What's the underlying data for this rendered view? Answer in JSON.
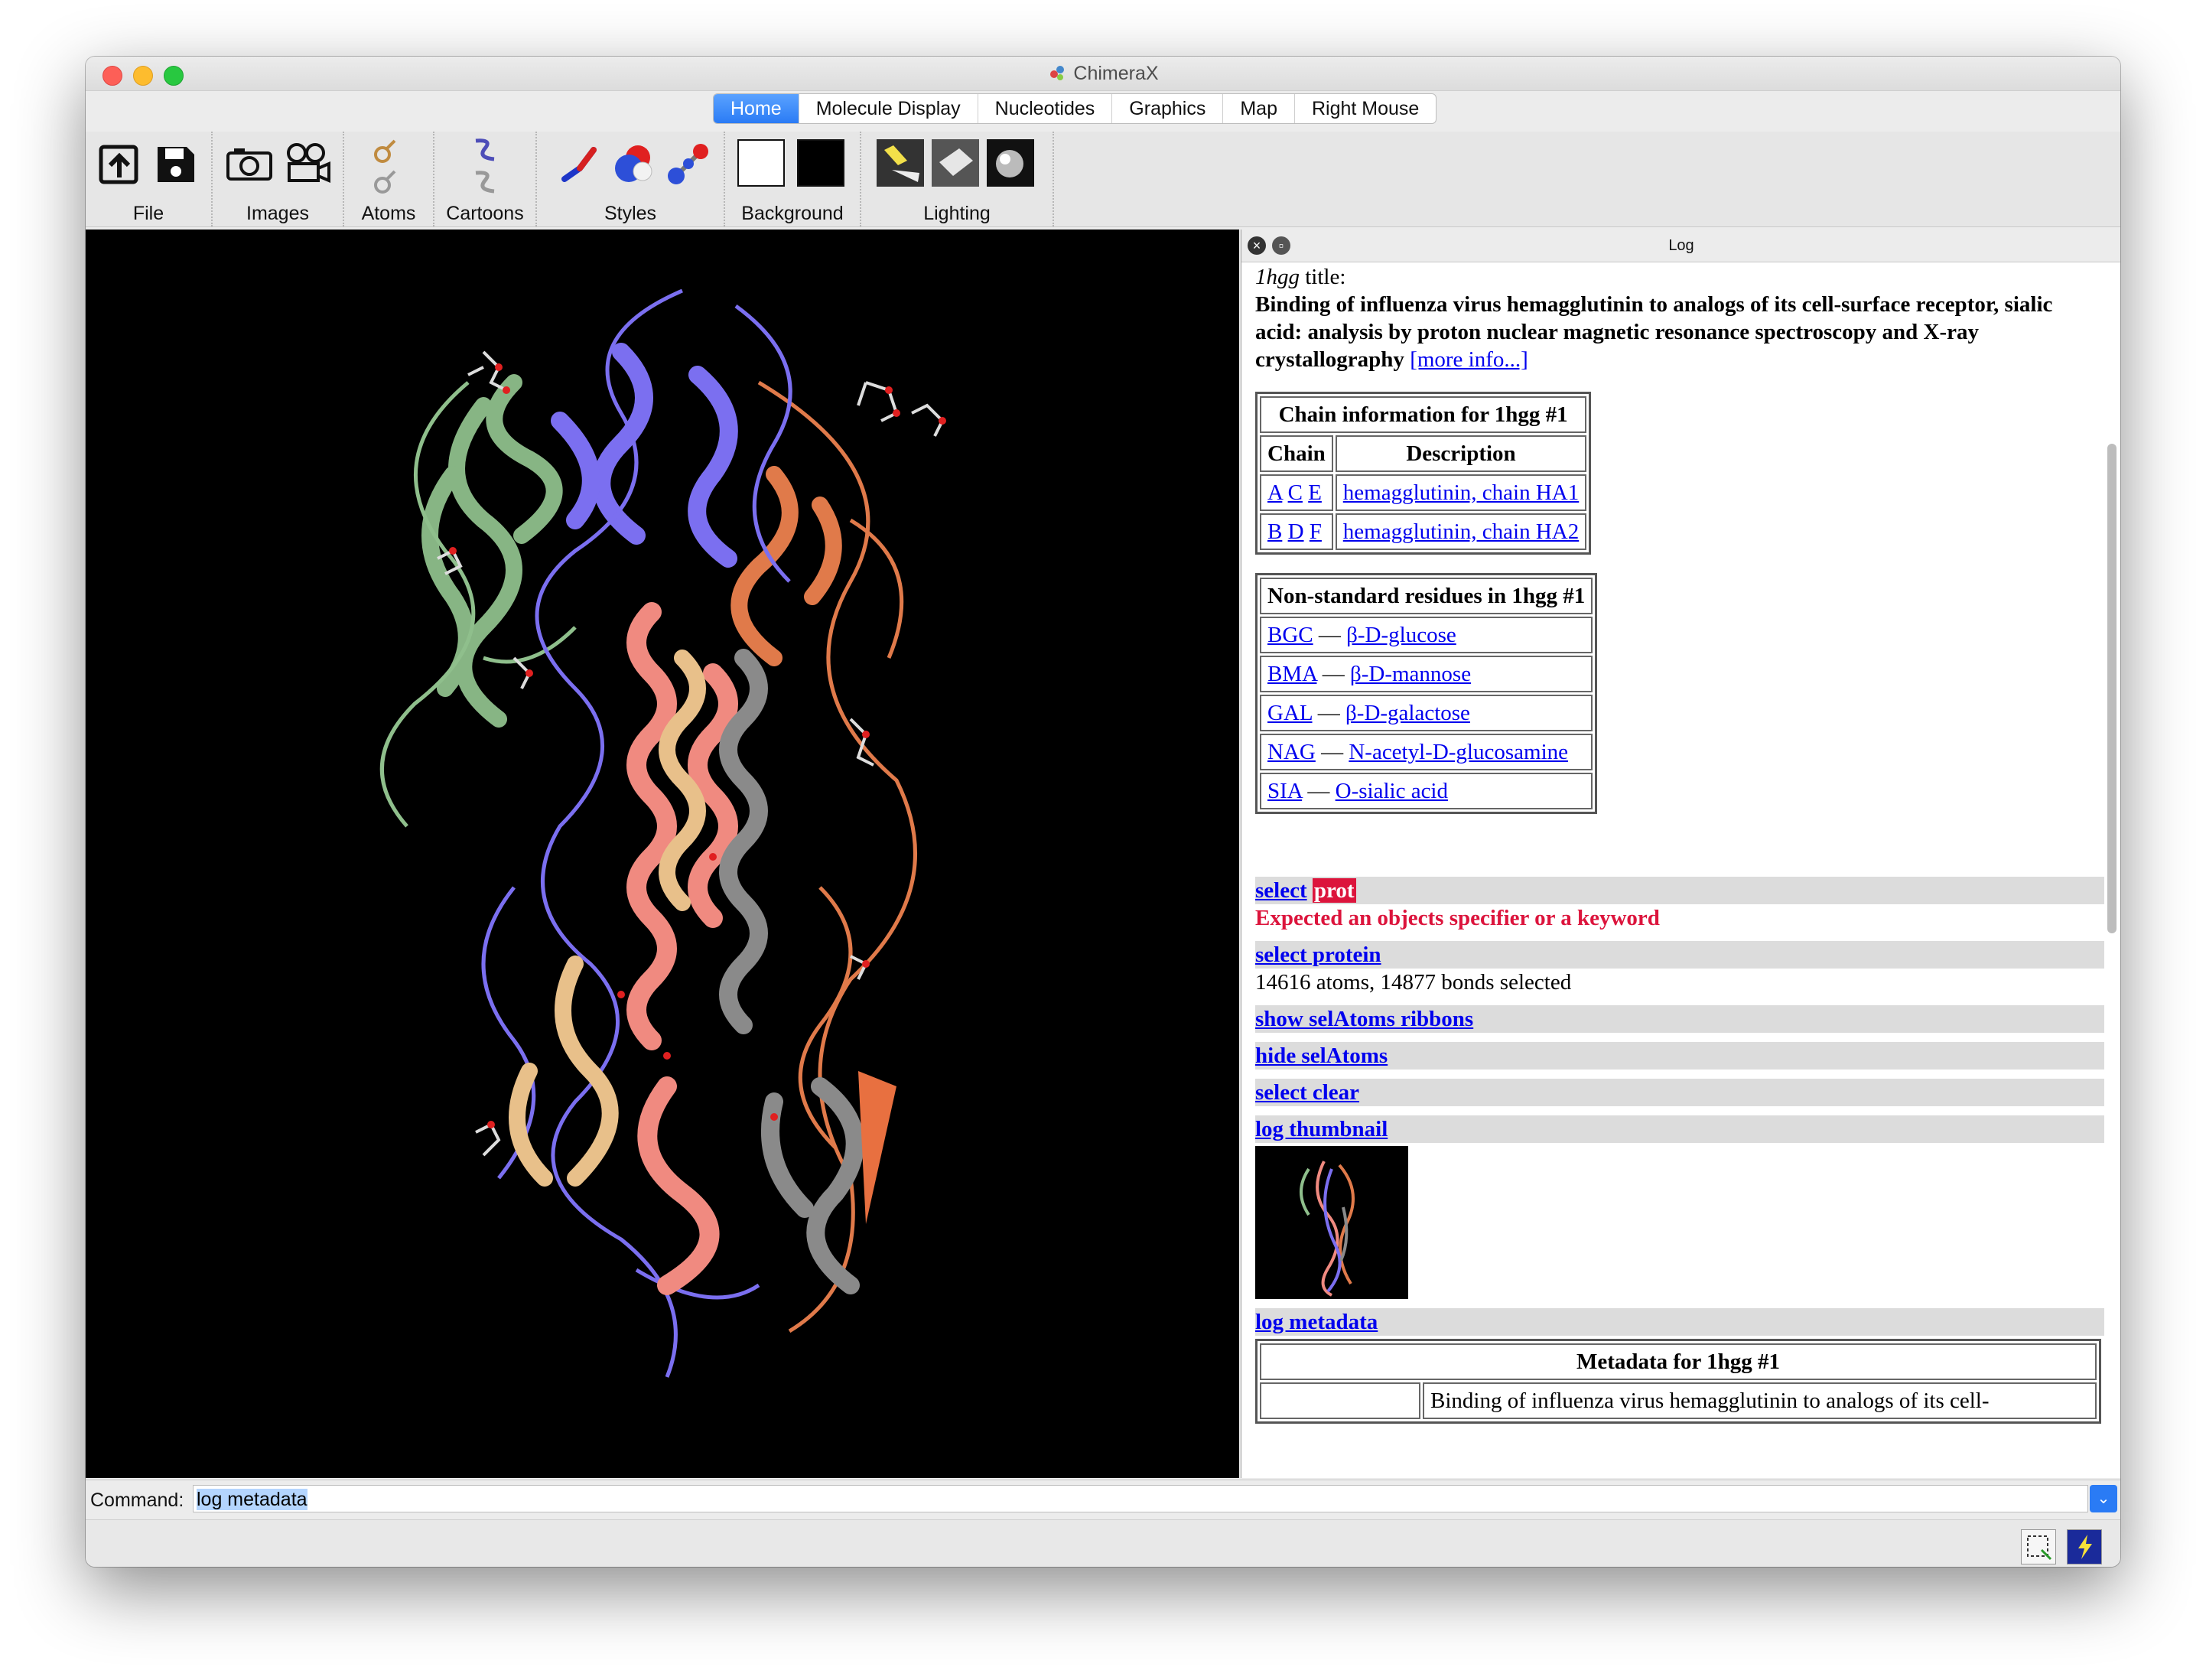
{
  "window": {
    "title": "ChimeraX"
  },
  "tabs": [
    "Home",
    "Molecule Display",
    "Nucleotides",
    "Graphics",
    "Map",
    "Right Mouse"
  ],
  "toolbar": {
    "groups": [
      "File",
      "Images",
      "Atoms",
      "Cartoons",
      "Styles",
      "Background",
      "Lighting"
    ]
  },
  "log": {
    "title": "Log",
    "entry_id": "1hgg",
    "title_suffix": " title:",
    "structure_title": "Binding of influenza virus hemagglutinin to analogs of its cell-surface receptor, sialic acid: analysis by proton nuclear magnetic resonance spectroscopy and X-ray crystallography",
    "more_info": "[more info...]",
    "chain_table": {
      "caption": "Chain information for 1hgg #1",
      "headers": [
        "Chain",
        "Description"
      ],
      "rows": [
        {
          "chains": [
            "A",
            "C",
            "E"
          ],
          "description": "hemagglutinin, chain HA1"
        },
        {
          "chains": [
            "B",
            "D",
            "F"
          ],
          "description": "hemagglutinin, chain HA2"
        }
      ]
    },
    "residue_table": {
      "caption": "Non-standard residues in 1hgg #1",
      "rows": [
        {
          "code": "BGC",
          "name": "β-D-glucose"
        },
        {
          "code": "BMA",
          "name": "β-D-mannose"
        },
        {
          "code": "GAL",
          "name": "β-D-galactose"
        },
        {
          "code": "NAG",
          "name": "N-acetyl-D-glucosamine"
        },
        {
          "code": "SIA",
          "name": "O-sialic acid"
        }
      ],
      "dash": "—"
    },
    "cmd1": {
      "verb": "select",
      "arg": "prot",
      "error": "Expected an objects specifier or a keyword"
    },
    "cmd2": {
      "text": "select protein",
      "result": "14616 atoms, 14877 bonds selected"
    },
    "cmd3": "show selAtoms ribbons",
    "cmd4": "hide selAtoms",
    "cmd5": "select clear",
    "cmd6": "log thumbnail",
    "cmd7": "log metadata",
    "metadata": {
      "caption": "Metadata for 1hgg #1",
      "first_value": "Binding of influenza virus hemagglutinin to analogs of its cell-"
    }
  },
  "command": {
    "label": "Command:",
    "value": "log metadata"
  },
  "colors": {
    "chain_green": "#8fbf8c",
    "chain_purple": "#7b6ff0",
    "chain_orange": "#e07a4a",
    "chain_salmon": "#f08a80",
    "chain_tan": "#e8c08a",
    "chain_gray": "#8a8a8a",
    "error_red": "#dc143c",
    "accent_blue": "#2a7bf5"
  }
}
